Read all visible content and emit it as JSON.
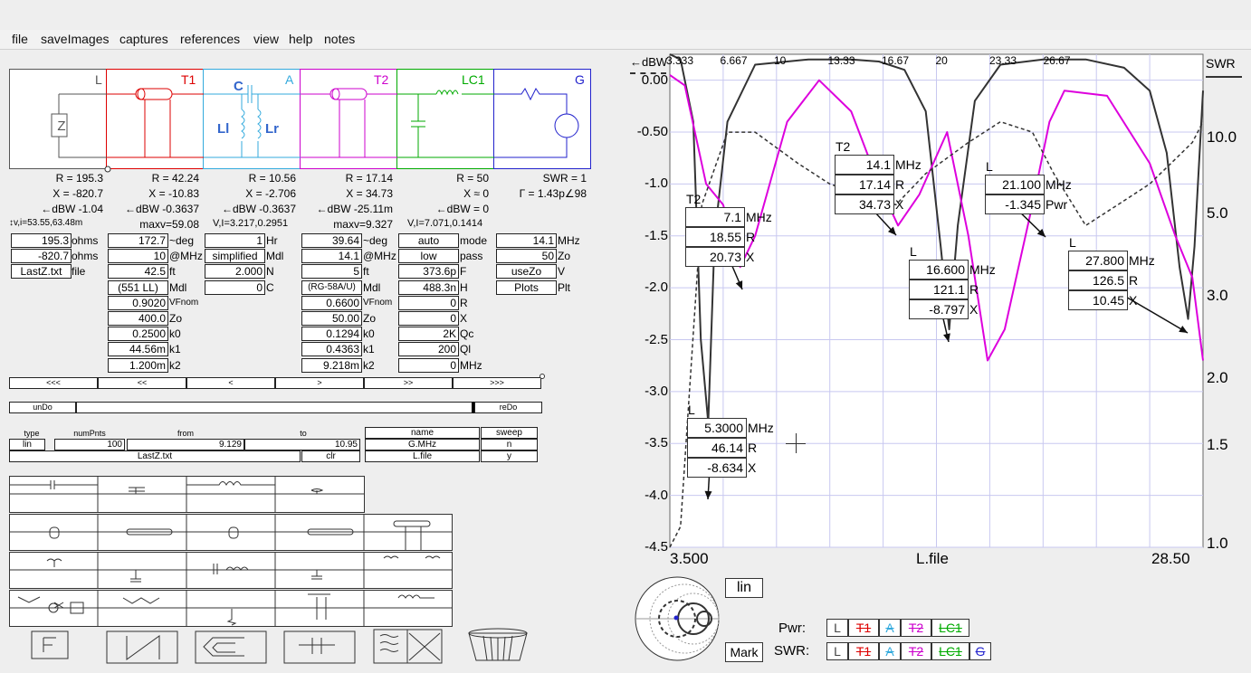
{
  "menu": [
    "file",
    "saveImages",
    "captures",
    "references",
    "view",
    "help",
    "notes"
  ],
  "schem": {
    "labels": [
      {
        "t": "L",
        "c": "#555555"
      },
      {
        "t": "T1",
        "c": "#dd0000"
      },
      {
        "t": "A",
        "c": "#33aadd"
      },
      {
        "t": "T2",
        "c": "#cc00cc"
      },
      {
        "t": "LC1",
        "c": "#00aa00"
      },
      {
        "t": "G",
        "c": "#2222cc"
      }
    ],
    "comp": {
      "z": "Z",
      "c": "C",
      "ll": "Ll",
      "lr": "Lr"
    }
  },
  "readouts": [
    [
      "R = 195.3",
      "X = -820.7",
      "←dBW -1.04",
      "↕v,i=53.55,63.48m"
    ],
    [
      "R = 42.24",
      "X = -10.83",
      "←dBW -0.3637",
      "maxv=59.08"
    ],
    [
      "R = 10.56",
      "X = -2.706",
      "←dBW -0.3637",
      "V,I=3.217,0.2951"
    ],
    [
      "R = 17.14",
      "X = 34.73",
      "←dBW -25.11m",
      "maxv=9.327"
    ],
    [
      "R = 50",
      "X ≈ 0",
      "←dBW = 0",
      "V,I=7.071,0.1414"
    ],
    [
      "SWR = 1",
      "Γ = 1.43p∠98"
    ]
  ],
  "colL": {
    "vals": [
      "195.3",
      "-820.7"
    ],
    "labs": [
      "ohms",
      "ohms"
    ],
    "file": "LastZ.txt",
    "filelab": "file"
  },
  "colT1": {
    "vals": [
      "172.7",
      "10",
      "42.5",
      "(551 LL)",
      "0.9020",
      "400.0",
      "0.2500",
      "44.56m",
      "1.200m"
    ],
    "labs": [
      "~deg",
      "@MHz",
      "ft",
      "Mdl",
      "VFnom",
      "Zo",
      "k0",
      "k1",
      "k2"
    ]
  },
  "colA": {
    "vals": [
      "1",
      "simplified",
      "2.000",
      "0"
    ],
    "labs": [
      "Hr",
      "Mdl",
      "N",
      "C"
    ]
  },
  "colT2": {
    "vals": [
      "39.64",
      "14.1",
      "5",
      "(RG-58A/U)",
      "0.6600",
      "50.00",
      "0.1294",
      "0.4363",
      "9.218m"
    ],
    "labs": [
      "~deg",
      "@MHz",
      "ft",
      "Mdl",
      "VFnom",
      "Zo",
      "k0",
      "k1",
      "k2"
    ]
  },
  "colLC": {
    "vals": [
      "auto",
      "low",
      "373.6p",
      "488.3n",
      "0",
      "0",
      "2K",
      "200",
      "0"
    ],
    "labs": [
      "mode",
      "pass",
      "F",
      "H",
      "R",
      "X",
      "Qc",
      "Ql",
      "MHz"
    ]
  },
  "colG": {
    "vals": [
      "14.1",
      "50",
      "useZo",
      "Plots"
    ],
    "labs": [
      "MHz",
      "Zo",
      "V",
      "Plt"
    ]
  },
  "nav": [
    "<<<",
    "<<",
    "<",
    ">",
    ">>",
    ">>>"
  ],
  "undo": "unDo",
  "redo": "reDo",
  "sweep": {
    "hdrs": [
      "type",
      "numPnts",
      "from",
      "to",
      "name",
      "sweep"
    ],
    "type": "lin",
    "numPnts": "100",
    "from": "9.129",
    "to": "10.95",
    "file": "LastZ.txt",
    "clr": "clr",
    "name": "G.MHz",
    "lfile": "L.file",
    "sw1": "n",
    "sw2": "y"
  },
  "chart": {
    "dbw_label": "←dBW",
    "swr_label": "SWR",
    "x_top_ticks": [
      "3.333",
      "6.667",
      "10",
      "13.33",
      "16.67",
      "20",
      "23.33",
      "26.67"
    ],
    "y_left_ticks": [
      "0.00",
      "-0.50",
      "-1.0",
      "-1.5",
      "-2.0",
      "-2.5",
      "-3.0",
      "-3.5",
      "-4.0",
      "-4.5"
    ],
    "y_right_ticks": [
      "10.0",
      "5.0",
      "3.0",
      "2.0",
      "1.5",
      "1.0"
    ],
    "x_min": "3.500",
    "x_max": "28.50",
    "x_name": "L.file"
  },
  "chart_data": {
    "type": "line",
    "xlim": [
      3.5,
      28.5
    ],
    "ylim": [
      -4.5,
      0.25
    ],
    "xlabel": "L.file",
    "ylabel": "←dBW",
    "y2label": "SWR",
    "series": [
      {
        "color": "#333333",
        "style": "solid",
        "x": [
          3.5,
          4.0,
          4.6,
          4.95,
          5.3,
          5.6,
          6.2,
          7.5,
          10,
          12,
          13.3,
          14.5,
          15.5,
          16.2,
          16.6,
          17.0,
          17.8,
          19,
          21,
          23,
          24.8,
          26,
          26.8,
          27.4,
          27.8,
          28.1,
          28.5
        ],
        "y": [
          0.25,
          0.2,
          -0.4,
          -2.5,
          -3.3,
          -1.5,
          -0.4,
          0.15,
          0.2,
          0.2,
          0.18,
          0.1,
          -0.3,
          -1.6,
          -2.4,
          -1.4,
          -0.2,
          0.15,
          0.2,
          0.2,
          0.12,
          -0.1,
          -0.7,
          -1.8,
          -2.3,
          -1.6,
          -0.1
        ]
      },
      {
        "color": "#dd00dd",
        "style": "solid",
        "x": [
          3.5,
          4.2,
          5.2,
          6.0,
          6.8,
          7.5,
          9,
          10.5,
          12,
          13.3,
          14.2,
          15.2,
          16.5,
          17.5,
          18.4,
          19.2,
          20.5,
          21.3,
          22,
          24,
          26,
          27.2,
          28.0,
          28.5
        ],
        "y": [
          0.05,
          -0.05,
          -1.0,
          -1.2,
          -1.8,
          -1.5,
          -0.4,
          0.0,
          -0.3,
          -1.0,
          -1.4,
          -1.1,
          -0.5,
          -1.5,
          -2.7,
          -2.4,
          -1.2,
          -0.4,
          -0.1,
          -0.15,
          -0.8,
          -1.5,
          -1.9,
          -2.7
        ]
      },
      {
        "color": "#333333",
        "style": "dashed",
        "x": [
          3.5,
          4.0,
          5.0,
          6.2,
          7.5,
          9.5,
          11,
          12.5,
          14.1,
          15.5,
          17.5,
          19,
          20.5,
          21.5,
          23,
          24.5,
          26,
          27,
          28,
          28.5
        ],
        "y": [
          -4.5,
          -4.3,
          -1.2,
          -0.5,
          -0.5,
          -0.8,
          -1.0,
          -1.1,
          -1.2,
          -0.9,
          -0.6,
          -0.4,
          -0.5,
          -0.9,
          -1.4,
          -1.2,
          -1.0,
          -0.8,
          -0.6,
          -0.4
        ]
      }
    ],
    "annotations": [
      {
        "tag": "T2",
        "vals": [
          "7.1",
          "18.55",
          "20.73"
        ],
        "units": [
          "MHz",
          "R",
          "X"
        ]
      },
      {
        "tag": "T2",
        "vals": [
          "14.1",
          "17.14",
          "34.73"
        ],
        "units": [
          "MHz",
          "R",
          "X"
        ]
      },
      {
        "tag": "L",
        "vals": [
          "21.100",
          "-1.345"
        ],
        "units": [
          "MHz",
          "Pwr"
        ]
      },
      {
        "tag": "L",
        "vals": [
          "16.600",
          "121.1",
          "-8.797"
        ],
        "units": [
          "MHz",
          "R",
          "X"
        ]
      },
      {
        "tag": "L",
        "vals": [
          "27.800",
          "126.5",
          "10.45"
        ],
        "units": [
          "MHz",
          "R",
          "X"
        ]
      },
      {
        "tag": "L",
        "vals": [
          "5.3000",
          "46.14",
          "-8.634"
        ],
        "units": [
          "MHz",
          "R",
          "X"
        ]
      }
    ]
  },
  "bottom": {
    "lin": "lin",
    "mark": "Mark",
    "pwr": "Pwr:",
    "swr": "SWR:",
    "pwr_items": [
      "L",
      "T1",
      "A",
      "T2",
      "LC1"
    ],
    "swr_items": [
      "L",
      "T1",
      "A",
      "T2",
      "LC1",
      "G"
    ]
  },
  "colors": {
    "L": "#444444",
    "T1": "#dd0000",
    "A": "#33aadd",
    "T2": "#cc00cc",
    "LC1": "#00aa00",
    "G": "#2222cc"
  }
}
